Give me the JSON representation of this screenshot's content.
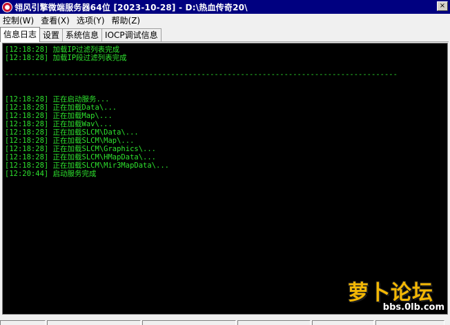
{
  "window": {
    "title": "翎风引擎微端服务器64位 [2023-10-28] - D:\\热血传奇20\\",
    "icon": "app-logo-icon",
    "close_glyph": "×"
  },
  "menu": [
    {
      "label": "控制(W)"
    },
    {
      "label": "查看(X)"
    },
    {
      "label": "选项(Y)"
    },
    {
      "label": "帮助(Z)"
    }
  ],
  "tabs": [
    {
      "label": "信息日志",
      "active": true
    },
    {
      "label": "设置",
      "active": false
    },
    {
      "label": "系统信息",
      "active": false
    },
    {
      "label": "IOCP调试信息",
      "active": false
    }
  ],
  "log": {
    "color": "#2ee22e",
    "header_lines": [
      "[12:18:28] 加载IP过滤列表完成",
      "[12:18:28] 加载IP段过滤列表完成"
    ],
    "separator": "------------------------------------------------------------------------------------------",
    "lines": [
      "[12:18:28] 正在启动服务...",
      "[12:18:28] 正在加载Data\\...",
      "[12:18:28] 正在加载Map\\...",
      "[12:18:28] 正在加载Wav\\...",
      "[12:18:28] 正在加载SLCM\\Data\\...",
      "[12:18:28] 正在加载SLCM\\Map\\...",
      "[12:18:28] 正在加载SLCM\\Graphics\\...",
      "[12:18:28] 正在加载SLCM\\HMapData\\...",
      "[12:18:28] 正在加载SLCM\\Mir3MapData\\...",
      "[12:20:44] 启动服务完成"
    ]
  },
  "watermark": {
    "text": "萝卜论坛",
    "url": "bbs.0lb.com"
  }
}
